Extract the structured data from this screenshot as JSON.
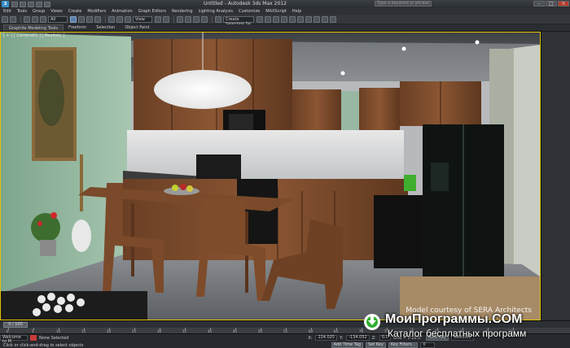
{
  "titlebar": {
    "logo_text": "3",
    "title": "Untitled - Autodesk 3ds Max 2012",
    "search_placeholder": "Type a keyword or phrase"
  },
  "menu": [
    "Edit",
    "Tools",
    "Group",
    "Views",
    "Create",
    "Modifiers",
    "Animation",
    "Graph Editors",
    "Rendering",
    "Lighting Analysis",
    "Customize",
    "MAXScript",
    "Help"
  ],
  "toolbar": {
    "filter_value": "All",
    "view_value": "View",
    "selection_set_placeholder": "Create Selection Se"
  },
  "ribbon": {
    "tabs": [
      "Graphite Modeling Tools",
      "Freeform",
      "Selection",
      "Object Paint"
    ]
  },
  "viewport": {
    "label": "[ + ] [ Camera01 ] [ Realistic ]",
    "credit": "Model courtesy of SERA Architects"
  },
  "timeline": {
    "slider_label": "0 / 100",
    "ticks": [
      "0",
      "5",
      "10",
      "15",
      "20",
      "25",
      "30",
      "35",
      "40",
      "45",
      "50",
      "55",
      "60",
      "65",
      "70",
      "75",
      "80",
      "85",
      "90",
      "95",
      "100"
    ]
  },
  "status": {
    "selection": "None Selected",
    "prompt": "Click or click-and-drag to select objects",
    "maxscript_label": "Welcome to M",
    "x_value": "224.025",
    "y_value": "-134.052",
    "z_value": "0.0",
    "grid_value": "Grid = 0'10.0\"",
    "autokey": "Auto Key",
    "selected": "Selected",
    "set_key": "Set Key",
    "key_filters": "Key Filters...",
    "add_time_tag": "Add Time Tag",
    "frame": "0"
  },
  "watermark": {
    "title": "МоиПрограммы.COM",
    "subtitle": "Каталог бесплатных программ"
  }
}
